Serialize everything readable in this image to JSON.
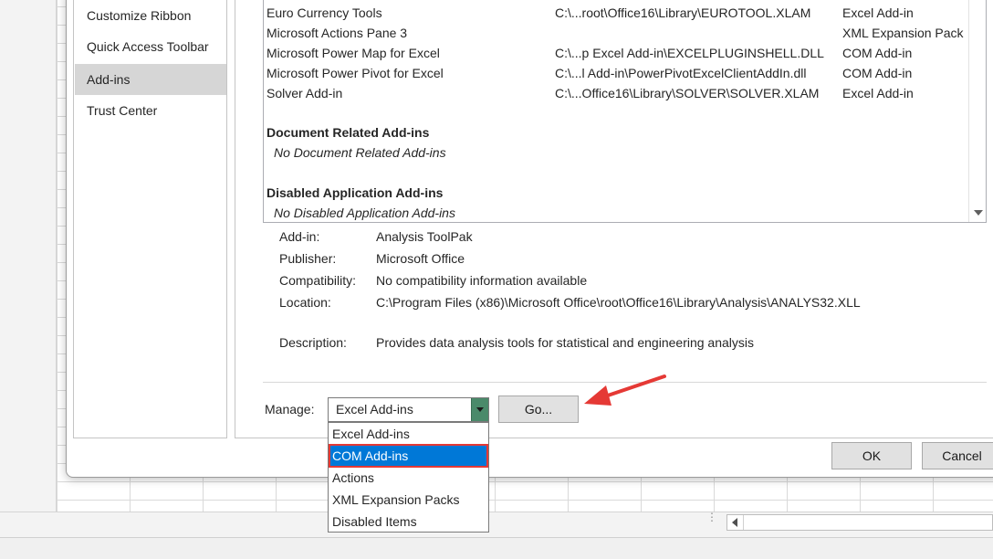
{
  "sidebar": {
    "items": [
      {
        "label": "Customize Ribbon"
      },
      {
        "label": "Quick Access Toolbar"
      },
      {
        "label": "Add-ins",
        "selected": true
      },
      {
        "label": "Trust Center"
      }
    ]
  },
  "addins_list": {
    "active_rows": [
      {
        "name": "Euro Currency Tools",
        "location": "C:\\...root\\Office16\\Library\\EUROTOOL.XLAM",
        "type": "Excel Add-in"
      },
      {
        "name": "Microsoft Actions Pane 3",
        "location": "",
        "type": "XML Expansion Pack"
      },
      {
        "name": "Microsoft Power Map for Excel",
        "location": "C:\\...p Excel Add-in\\EXCELPLUGINSHELL.DLL",
        "type": "COM Add-in"
      },
      {
        "name": "Microsoft Power Pivot for Excel",
        "location": "C:\\...l Add-in\\PowerPivotExcelClientAddIn.dll",
        "type": "COM Add-in"
      },
      {
        "name": "Solver Add-in",
        "location": "C:\\...Office16\\Library\\SOLVER\\SOLVER.XLAM",
        "type": "Excel Add-in"
      }
    ],
    "document_group": {
      "header": "Document Related Add-ins",
      "empty": "No Document Related Add-ins"
    },
    "disabled_group": {
      "header": "Disabled Application Add-ins",
      "empty": "No Disabled Application Add-ins"
    }
  },
  "details": {
    "addin_label": "Add-in:",
    "addin_value": "Analysis ToolPak",
    "publisher_label": "Publisher:",
    "publisher_value": "Microsoft Office",
    "compat_label": "Compatibility:",
    "compat_value": "No compatibility information available",
    "location_label": "Location:",
    "location_value": "C:\\Program Files (x86)\\Microsoft Office\\root\\Office16\\Library\\Analysis\\ANALYS32.XLL",
    "description_label": "Description:",
    "description_value": "Provides data analysis tools for statistical and engineering analysis"
  },
  "manage": {
    "label": "Manage:",
    "selected": "Excel Add-ins",
    "options": [
      "Excel Add-ins",
      "COM Add-ins",
      "Actions",
      "XML Expansion Packs",
      "Disabled Items"
    ],
    "highlighted_option": "COM Add-ins",
    "go_label": "Go..."
  },
  "buttons": {
    "ok": "OK",
    "cancel": "Cancel"
  },
  "colors": {
    "highlight": "#0078d7",
    "annotation": "#e53935",
    "dropdown_arrow_bg": "#4a8a6a"
  },
  "icons": {
    "annotation_arrow": "red-arrow-icon",
    "dropdown": "chevron-down-icon",
    "scroll_down": "scroll-down-arrow-icon",
    "scroll_left": "scroll-left-arrow-icon"
  }
}
